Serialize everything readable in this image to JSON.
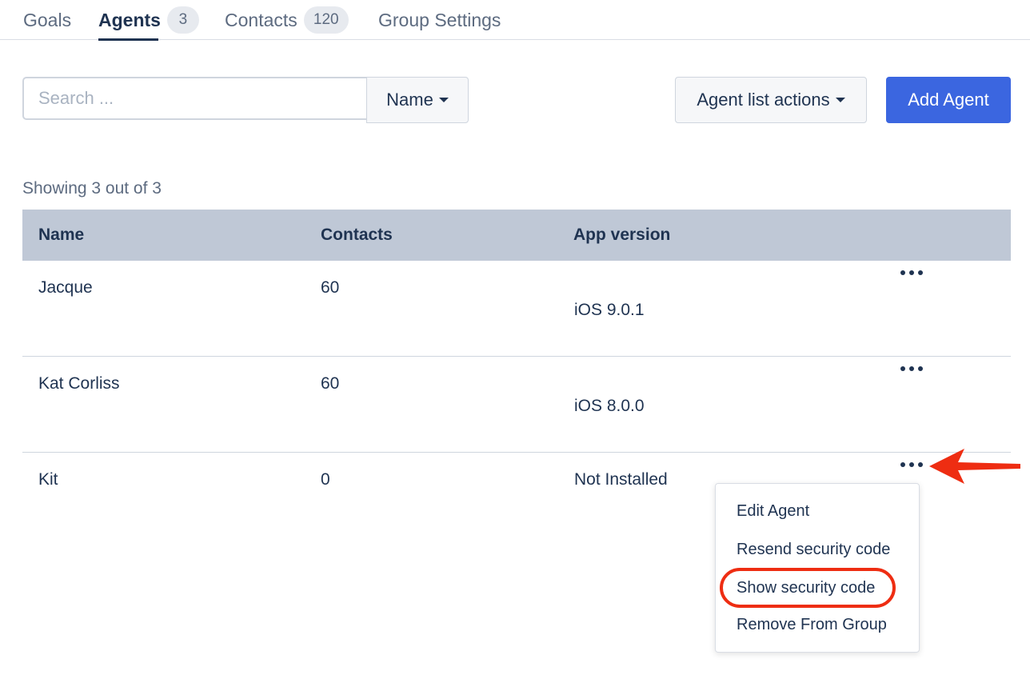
{
  "tabs": [
    {
      "label": "Goals"
    },
    {
      "label": "Agents",
      "count": "3"
    },
    {
      "label": "Contacts",
      "count": "120"
    },
    {
      "label": "Group Settings"
    }
  ],
  "toolbar": {
    "search_placeholder": "Search ...",
    "sort_label": "Name",
    "actions_label": "Agent list actions",
    "add_label": "Add Agent"
  },
  "showing_text": "Showing 3 out of 3",
  "table": {
    "columns": [
      "Name",
      "Contacts",
      "App version"
    ],
    "rows": [
      {
        "name": "Jacque",
        "contacts": "60",
        "app_version": "iOS 9.0.1"
      },
      {
        "name": "Kat Corliss",
        "contacts": "60",
        "app_version": "iOS 8.0.0"
      },
      {
        "name": "Kit",
        "contacts": "0",
        "app_version": "Not Installed"
      }
    ]
  },
  "row_menu": {
    "items": [
      "Edit Agent",
      "Resend security code",
      "Show security code",
      "Remove From Group"
    ],
    "highlighted_item": "Show security code"
  },
  "colors": {
    "primary": "#3b66e0",
    "text": "#1f3351",
    "header_bg": "#bfc8d6",
    "annotation": "#ee2d12"
  },
  "icons": {
    "row_actions": "more-horizontal-icon",
    "caret": "caret-down-icon",
    "annotation_arrow": "arrow-left-icon"
  }
}
